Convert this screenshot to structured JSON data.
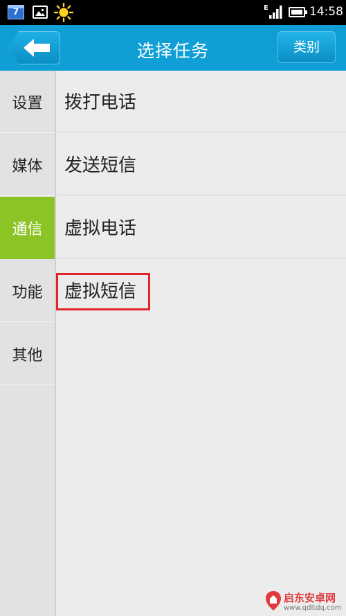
{
  "status_bar": {
    "calendar_day": "7",
    "network_type": "E",
    "time": "14:58",
    "icons": [
      "calendar-icon",
      "gallery-icon",
      "weather-sun-icon",
      "signal-icon",
      "battery-icon"
    ]
  },
  "header": {
    "title": "选择任务",
    "back_icon": "arrow-left-icon",
    "category_label": "类别"
  },
  "sidebar": {
    "items": [
      {
        "label": "设置",
        "active": false
      },
      {
        "label": "媒体",
        "active": false
      },
      {
        "label": "通信",
        "active": true
      },
      {
        "label": "功能",
        "active": false
      },
      {
        "label": "其他",
        "active": false
      }
    ]
  },
  "tasks": {
    "items": [
      {
        "label": "拨打电话"
      },
      {
        "label": "发送短信"
      },
      {
        "label": "虚拟电话"
      },
      {
        "label": "虚拟短信",
        "highlighted": true
      }
    ]
  },
  "watermark": {
    "name": "启东安卓网",
    "url": "www.qdltdq.com"
  },
  "colors": {
    "header": "#0f9fd6",
    "sidebar_active": "#8cc425",
    "highlight": "#e2232a"
  }
}
